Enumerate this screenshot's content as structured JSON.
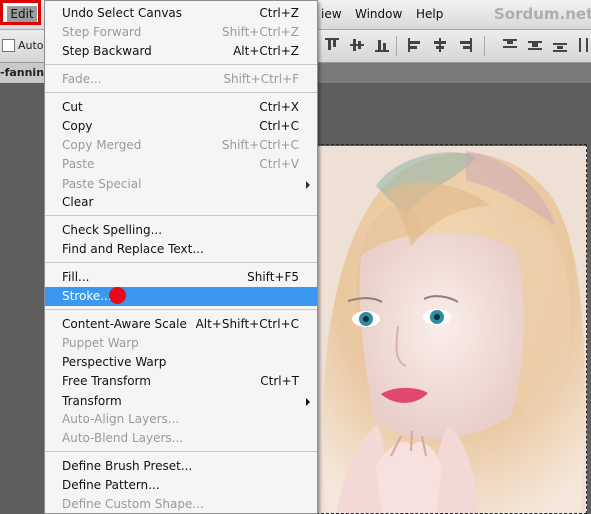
{
  "menubar": {
    "edit_label": "Edit",
    "items": [
      "iew",
      "Window",
      "Help"
    ],
    "watermark": "Sordum.net"
  },
  "optionsbar": {
    "auto_label": "Auto-"
  },
  "document": {
    "tab_label": "-fanning"
  },
  "edit_menu": {
    "items": [
      {
        "label": "Undo Select Canvas",
        "shortcut": "Ctrl+Z",
        "disabled": false
      },
      {
        "label": "Step Forward",
        "shortcut": "Shift+Ctrl+Z",
        "disabled": true
      },
      {
        "label": "Step Backward",
        "shortcut": "Alt+Ctrl+Z",
        "disabled": false
      },
      {
        "label": "Fade...",
        "shortcut": "Shift+Ctrl+F",
        "disabled": true
      },
      {
        "label": "Cut",
        "shortcut": "Ctrl+X",
        "disabled": false
      },
      {
        "label": "Copy",
        "shortcut": "Ctrl+C",
        "disabled": false
      },
      {
        "label": "Copy Merged",
        "shortcut": "Shift+Ctrl+C",
        "disabled": true
      },
      {
        "label": "Paste",
        "shortcut": "Ctrl+V",
        "disabled": true
      },
      {
        "label": "Paste Special",
        "shortcut": "",
        "disabled": true,
        "submenu": true
      },
      {
        "label": "Clear",
        "shortcut": "",
        "disabled": false
      },
      {
        "label": "Check Spelling...",
        "shortcut": "",
        "disabled": false
      },
      {
        "label": "Find and Replace Text...",
        "shortcut": "",
        "disabled": false
      },
      {
        "label": "Fill...",
        "shortcut": "Shift+F5",
        "disabled": false
      },
      {
        "label": "Stroke...",
        "shortcut": "",
        "disabled": false,
        "highlighted": true
      },
      {
        "label": "Content-Aware Scale",
        "shortcut": "Alt+Shift+Ctrl+C",
        "disabled": false
      },
      {
        "label": "Puppet Warp",
        "shortcut": "",
        "disabled": true
      },
      {
        "label": "Perspective Warp",
        "shortcut": "",
        "disabled": false
      },
      {
        "label": "Free Transform",
        "shortcut": "Ctrl+T",
        "disabled": false
      },
      {
        "label": "Transform",
        "shortcut": "",
        "disabled": false,
        "submenu": true
      },
      {
        "label": "Auto-Align Layers...",
        "shortcut": "",
        "disabled": true
      },
      {
        "label": "Auto-Blend Layers...",
        "shortcut": "",
        "disabled": true
      },
      {
        "label": "Define Brush Preset...",
        "shortcut": "",
        "disabled": false
      },
      {
        "label": "Define Pattern...",
        "shortcut": "",
        "disabled": false
      },
      {
        "label": "Define Custom Shape...",
        "shortcut": "",
        "disabled": true
      }
    ]
  },
  "colors": {
    "highlight": "#3a98f0",
    "marker": "#e8091a",
    "edit_outline": "#e00000"
  }
}
